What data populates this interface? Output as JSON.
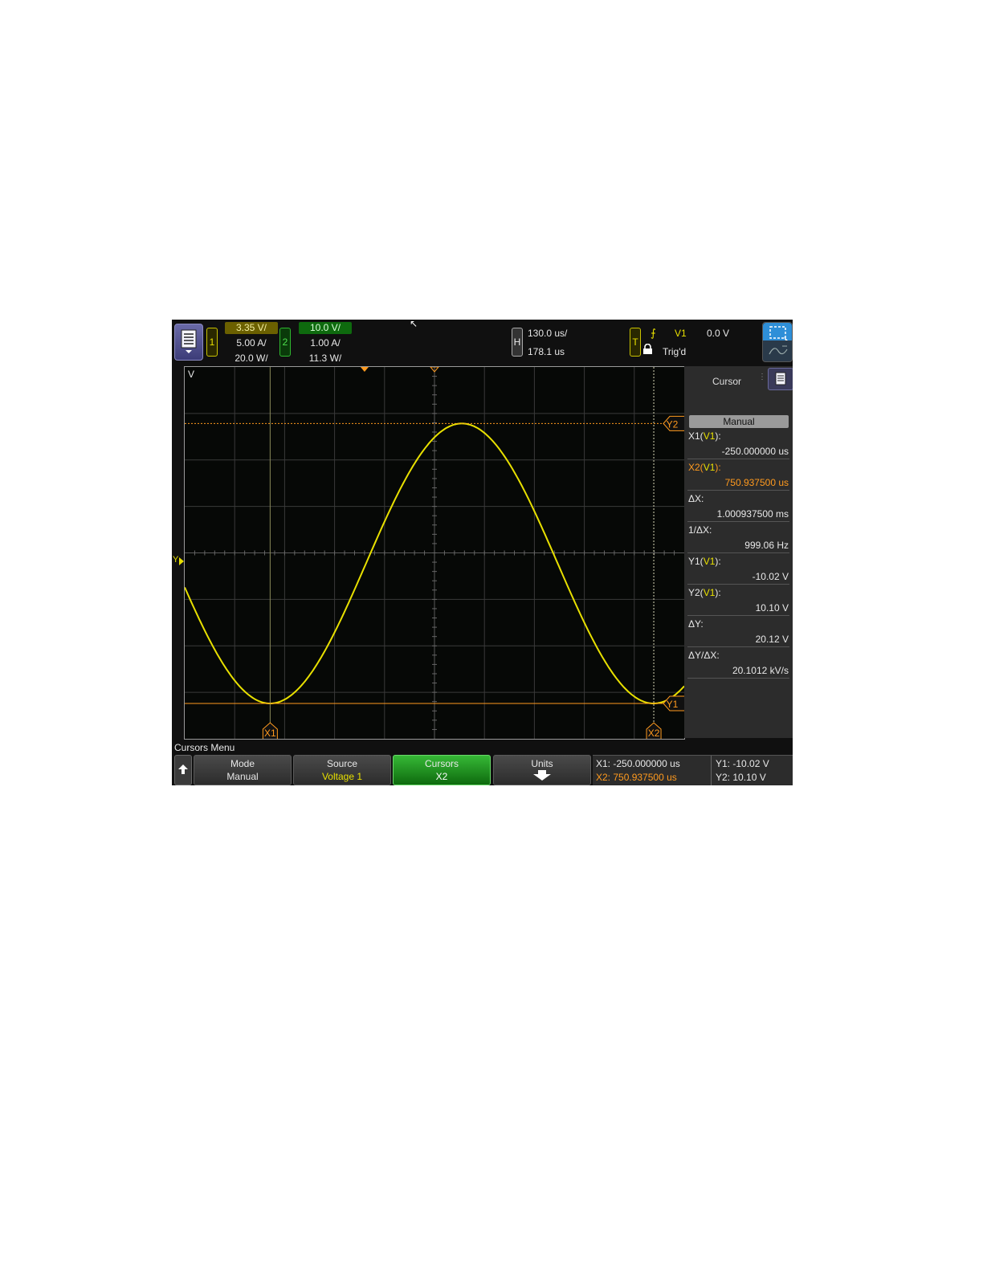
{
  "header": {
    "ch1": {
      "badge": "1",
      "scale": "3.35 V/",
      "current": "5.00 A/",
      "power": "20.0 W/"
    },
    "ch2": {
      "badge": "2",
      "scale": "10.0 V/",
      "current": "1.00 A/",
      "power": "11.3 W/"
    },
    "horizontal": {
      "badge": "H",
      "timebase": "130.0 us/",
      "delay": "178.1 us"
    },
    "trigger": {
      "badge": "T",
      "source": "V1",
      "level": "0.0 V",
      "status": "Trig'd"
    }
  },
  "graticule": {
    "unit_label": "V",
    "ground_label": "Y",
    "x1_label": "X1",
    "x2_label": "X2",
    "y1_label": "Y1",
    "y2_label": "Y2"
  },
  "side_panel": {
    "title": "Cursor",
    "mode": "Manual",
    "rows": [
      {
        "label_pre": "X1(",
        "label_src": "V1",
        "label_post": "):",
        "value": "-250.000000 us",
        "color": "default"
      },
      {
        "label_pre": "X2(",
        "label_src": "V1",
        "label_post": "):",
        "value": "750.937500 us",
        "color": "orange"
      },
      {
        "label_pre": "ΔX:",
        "label_src": "",
        "label_post": "",
        "value": "1.000937500 ms",
        "color": "default"
      },
      {
        "label_pre": "1/ΔX:",
        "label_src": "",
        "label_post": "",
        "value": "999.06 Hz",
        "color": "default"
      },
      {
        "label_pre": "Y1(",
        "label_src": "V1",
        "label_post": "):",
        "value": "-10.02 V",
        "color": "default"
      },
      {
        "label_pre": "Y2(",
        "label_src": "V1",
        "label_post": "):",
        "value": "10.10 V",
        "color": "default"
      },
      {
        "label_pre": "ΔY:",
        "label_src": "",
        "label_post": "",
        "value": "20.12 V",
        "color": "default"
      },
      {
        "label_pre": "ΔY/ΔX:",
        "label_src": "",
        "label_post": "",
        "value": "20.1012 kV/s",
        "color": "default"
      }
    ]
  },
  "menu": {
    "title": "Cursors Menu",
    "softkeys": [
      {
        "label": "Mode",
        "value": "Manual"
      },
      {
        "label": "Source",
        "value": "Voltage 1"
      },
      {
        "label": "Cursors",
        "value": "X2"
      },
      {
        "label": "Units",
        "value": ""
      }
    ]
  },
  "readout": {
    "x1": "X1:  -250.000000 us",
    "x2": "X2:  750.937500 us",
    "y1": "Y1: -10.02 V",
    "y2": "Y2: 10.10 V"
  },
  "colors": {
    "trace": "#e8e000",
    "cursor_orange": "#ff9a1e",
    "softkey_active": "#1e8f1e"
  }
}
